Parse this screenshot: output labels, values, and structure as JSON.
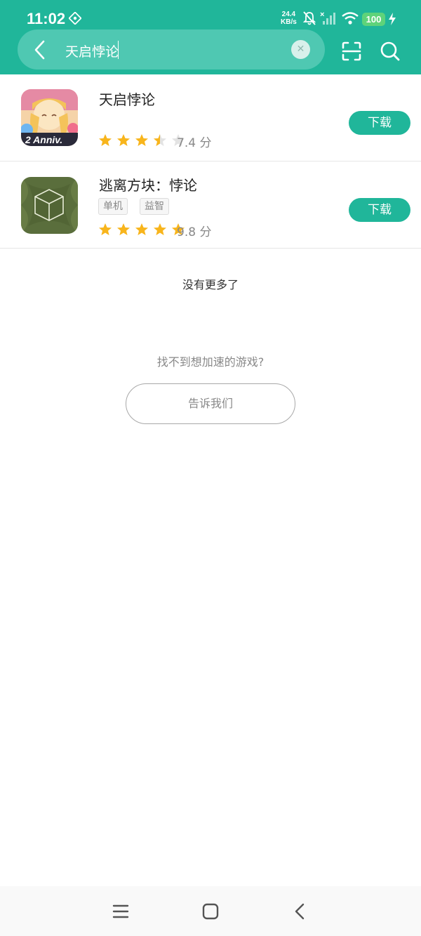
{
  "status_bar": {
    "time": "11:02",
    "net_speed_value": "24.4",
    "net_speed_unit": "KB/s",
    "battery": "100",
    "icons": [
      "vpn-icon",
      "mute-icon",
      "signal-icon",
      "wifi-icon",
      "charging-icon"
    ]
  },
  "search": {
    "query": "天启悖论",
    "back_icon": "back-arrow-icon",
    "clear_icon": "clear-icon",
    "clear_symbol": "✕",
    "scan_icon": "scan-icon",
    "search_icon": "search-icon"
  },
  "results": [
    {
      "name": "天启悖论",
      "tags": [],
      "rating": 3.5,
      "score": "7.4 分",
      "action": "下载"
    },
    {
      "name": "逃离方块：悖论",
      "tags": [
        "单机",
        "益智"
      ],
      "rating": 5,
      "score": "9.8 分",
      "action": "下载"
    }
  ],
  "footer": {
    "no_more": "没有更多了",
    "not_found": "找不到想加速的游戏?",
    "tell_us": "告诉我们"
  },
  "colors": {
    "accent": "#20b69a",
    "star": "#f8b51c",
    "star_empty": "#e3e3e3"
  },
  "nav_bar": {
    "icons": [
      "menu-icon",
      "home-icon",
      "back-icon"
    ]
  }
}
